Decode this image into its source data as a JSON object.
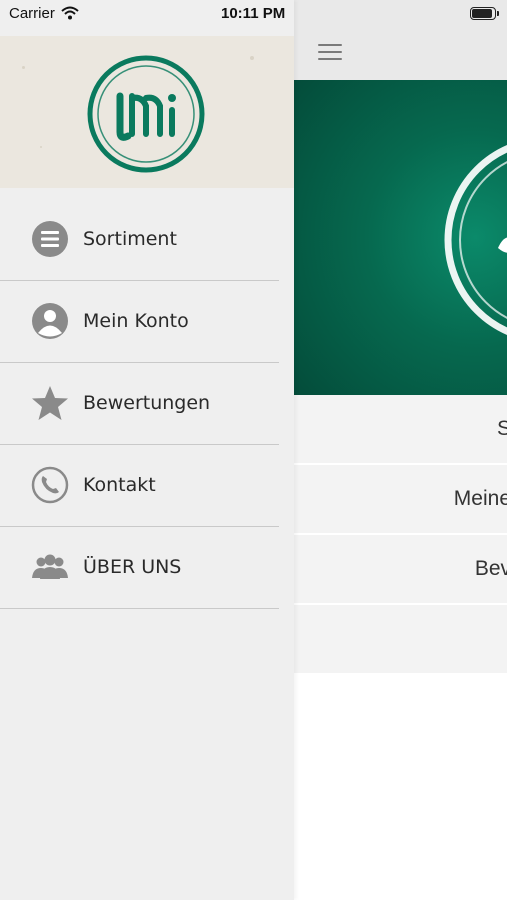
{
  "status_bar": {
    "carrier": "Carrier",
    "time": "10:11 PM"
  },
  "drawer": {
    "menu": [
      {
        "label": "Sortiment",
        "icon": "list-circle-icon"
      },
      {
        "label": "Mein Konto",
        "icon": "user-circle-icon"
      },
      {
        "label": "Bewertungen",
        "icon": "star-icon"
      },
      {
        "label": "Kontakt",
        "icon": "phone-icon"
      },
      {
        "label": "ÜBER UNS",
        "icon": "users-group-icon"
      }
    ]
  },
  "main": {
    "rows": [
      {
        "label": "S"
      },
      {
        "label": "Meine"
      },
      {
        "label": "Bev"
      },
      {
        "label": ""
      }
    ]
  },
  "colors": {
    "brand_green": "#0a7a5e",
    "drawer_bg": "#efefef",
    "icon_gray": "#8a8a8a"
  }
}
